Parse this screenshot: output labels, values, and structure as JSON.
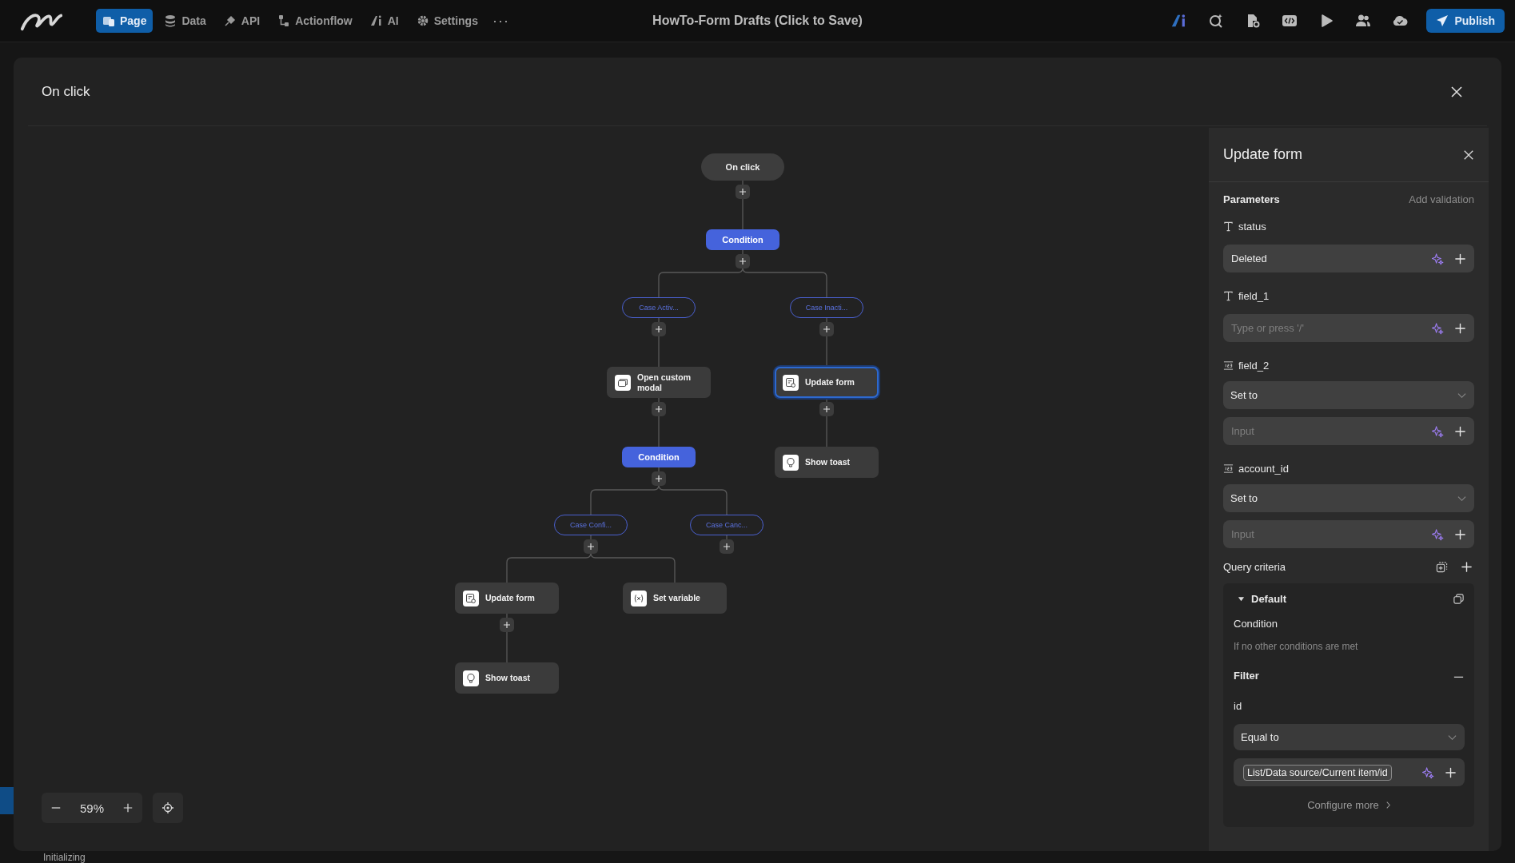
{
  "top_bar": {
    "nav": [
      {
        "label": "Page",
        "selected": true
      },
      {
        "label": "Data",
        "selected": false
      },
      {
        "label": "API",
        "selected": false
      },
      {
        "label": "Actionflow",
        "selected": false
      },
      {
        "label": "AI",
        "selected": false
      },
      {
        "label": "Settings",
        "selected": false
      }
    ],
    "more": "···",
    "title": "HowTo-Form Drafts (Click to Save)",
    "publish": "Publish"
  },
  "modal": {
    "title": "On click",
    "flow": {
      "label": "On click",
      "kind": "trigger",
      "children": [
        {
          "label": "Condition",
          "kind": "condition",
          "children": [
            {
              "label": "Case Activ...",
              "kind": "case",
              "children": [
                {
                  "label": "Open custom modal",
                  "kind": "modal",
                  "selected": false,
                  "children": [
                    {
                      "label": "Condition",
                      "kind": "condition",
                      "children": [
                        {
                          "label": "Case Confi...",
                          "kind": "case",
                          "children": [
                            {
                              "label": "Update form",
                              "kind": "form",
                              "selected": false,
                              "children": [
                                {
                                  "label": "Show toast",
                                  "kind": "toast",
                                  "selected": false
                                }
                              ]
                            },
                            {
                              "label": "Set variable",
                              "kind": "variable",
                              "selected": false
                            }
                          ]
                        },
                        {
                          "label": "Case Canc...",
                          "kind": "case"
                        }
                      ]
                    }
                  ]
                }
              ]
            },
            {
              "label": "Case Inacti...",
              "kind": "case",
              "children": [
                {
                  "label": "Update form",
                  "kind": "form",
                  "selected": true,
                  "children": [
                    {
                      "label": "Show toast",
                      "kind": "toast",
                      "selected": false
                    }
                  ]
                }
              ]
            }
          ]
        }
      ]
    },
    "zoom_text": "59%"
  },
  "side_panel": {
    "title": "Update form",
    "section": "Parameters",
    "add_validation": "Add validation",
    "params": [
      {
        "name": "status",
        "kind": "text",
        "value": "Deleted"
      },
      {
        "name": "field_1",
        "kind": "text",
        "placeholder": "Type or press '/'"
      },
      {
        "name": "field_2",
        "kind": "number",
        "mode": "Set to",
        "placeholder": "Input"
      },
      {
        "name": "account_id",
        "kind": "number",
        "mode": "Set to",
        "placeholder": "Input"
      }
    ],
    "query_label": "Query criteria",
    "criteria": {
      "name": "Default",
      "expanded": true,
      "condition_label": "Condition",
      "condition_text": "If no other conditions are met",
      "filter_label": "Filter",
      "filter_field": "id",
      "operator": "Equal to",
      "value": "List/Data source/Current item/id",
      "configure_more": "Configure more"
    }
  },
  "status_text": "Initializing"
}
